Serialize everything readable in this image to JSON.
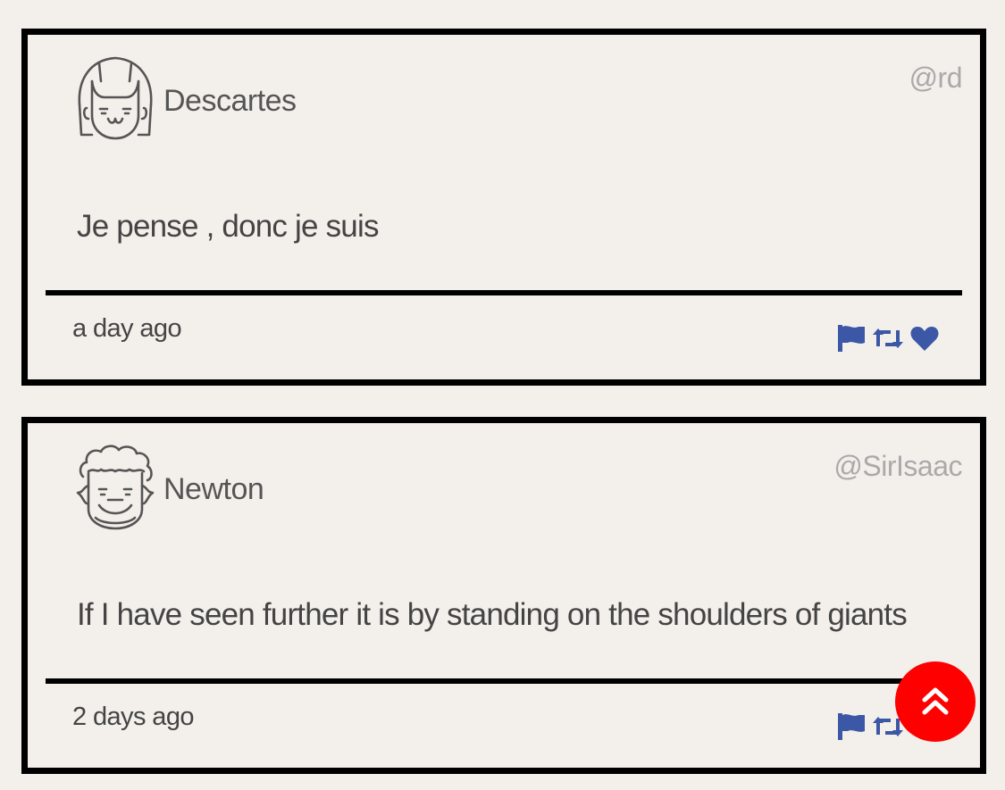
{
  "theme": {
    "background": "#f3f0eb",
    "border": "#000000",
    "action_icon_color": "#3b57a6",
    "scroll_button_color": "#ff0000"
  },
  "tweets": [
    {
      "avatar_icon": "girl-face-icon",
      "name": "Descartes",
      "handle": "@rd",
      "message": "Je pense , donc je suis",
      "time": "a day ago",
      "actions": [
        "flag-icon",
        "retweet-icon",
        "heart-icon"
      ]
    },
    {
      "avatar_icon": "curly-hair-face-icon",
      "name": "Newton",
      "handle": "@SirIsaac",
      "message": "If I have seen further it is by standing on the shoulders of giants",
      "time": "2 days ago",
      "actions": [
        "flag-icon",
        "retweet-icon",
        "heart-icon"
      ]
    }
  ],
  "scroll_top_button": {
    "icon": "double-chevron-up-icon"
  }
}
